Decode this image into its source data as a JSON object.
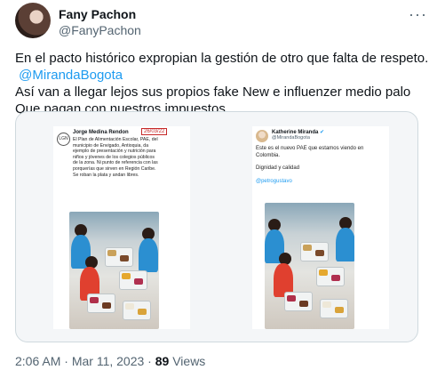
{
  "author": {
    "name": "Fany Pachon",
    "handle": "@FanyPachon",
    "avatar_icon": "profile-photo"
  },
  "menu_icon": "more-options-icon",
  "menu_glyph": "···",
  "tweet_text": {
    "line1": "En el pacto histórico expropian la gestión de otro que falta de respeto.",
    "mention": "@MirandaBogota",
    "line3": "Así van a llegar lejos sus propios fake New e influenzer medio palo",
    "line4": "Que pagan con nuestros impuestos ."
  },
  "media": {
    "left_card": {
      "logo": "LGN",
      "author": "Jorge Medina Rendon",
      "date": "26/03/22",
      "lines": [
        "El Plan de Alimentación Escolar, PAE, del",
        "municipio de Envigado, Antioquia, da",
        "ejemplo de presentación y nutrición para",
        "niños y jóvenes de los colegios públicos",
        "de la zona. Ni punto de referencia con las",
        "porquerías que sirven en Región Caribe.",
        "Se roban la plata y andan libres."
      ]
    },
    "right_card": {
      "author": "Katherine Miranda",
      "verified_icon": "verified-badge-icon",
      "handle": "@MirandaBogota",
      "lines": [
        "Este es el nuevo PAE que estamos viendo en",
        "Colombia."
      ],
      "line2": "Dignidad y calidad",
      "tag": "@petrogustavo"
    }
  },
  "meta": {
    "time": "2:06 AM",
    "date": "Mar 11, 2023",
    "views": "89",
    "views_label": "Views",
    "sep": " · "
  }
}
